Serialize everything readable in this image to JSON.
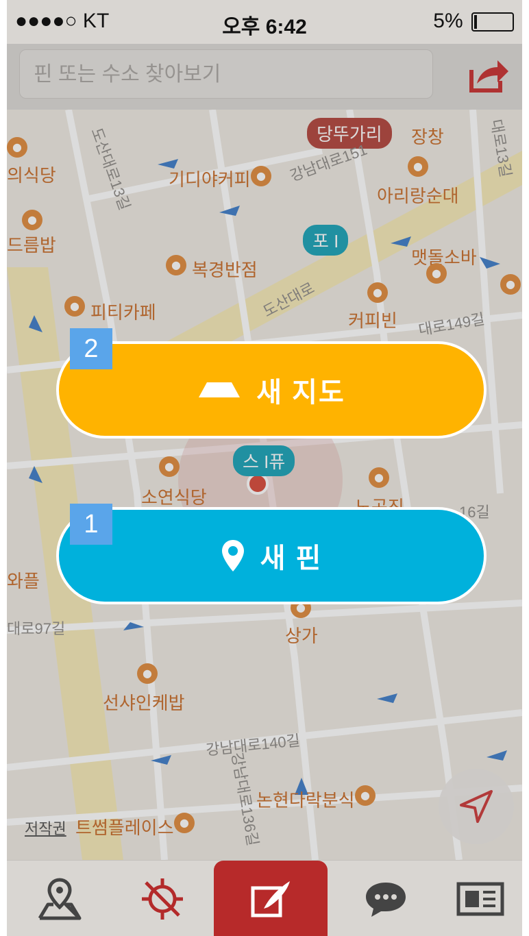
{
  "status_bar": {
    "carrier": "●●●●○ KT",
    "time": "오후 6:42",
    "battery": "5%"
  },
  "search": {
    "placeholder": "핀 또는 수소 찾아보기"
  },
  "map": {
    "places": {
      "dangtugari": "당뚜가리",
      "jangchang": "장창",
      "gidiya_cafe": "기디야커피",
      "arirang": "아리랑순대",
      "info": "포 I",
      "maetdol": "맷돌소바",
      "bokgyeong": "복경반점",
      "pitti_cafe": "피티카페",
      "coffee_bean": "커피빈",
      "sipu": "스 I퓨",
      "soyeon": "소연식당",
      "nogol": "노곤진",
      "wafle": "와플",
      "sangga": "상가",
      "seonsha": "선샤인케밥",
      "nonhyeon": "논현다락분식",
      "trusplace": "트썸플레이스",
      "left_food": "의식당",
      "left_drum": "드름밥"
    },
    "roads": {
      "dosan": "도산대로",
      "dosan_13": "도산대로13길",
      "gangnam_151": "강남대로151",
      "gangnam_140": "강남대로140길",
      "gangnam_136": "강남대로136길",
      "gangnam_97": "대로97길",
      "road_16": "16길",
      "road_149": "대로149길",
      "road_13": "대로13길"
    },
    "copyright": "저작권"
  },
  "buttons": {
    "new_map": "새 지도",
    "new_pin": "새 핀",
    "badge_map": "2",
    "badge_pin": "1"
  },
  "colors": {
    "new_map": "#ffb300",
    "new_pin": "#00b1dc",
    "accent": "#b72a2a",
    "badge": "#5aa5ea"
  },
  "tabs": [
    {
      "icon": "map-pin-icon"
    },
    {
      "icon": "compass-icon"
    },
    {
      "icon": "compose-icon"
    },
    {
      "icon": "chat-icon"
    },
    {
      "icon": "news-icon"
    }
  ]
}
